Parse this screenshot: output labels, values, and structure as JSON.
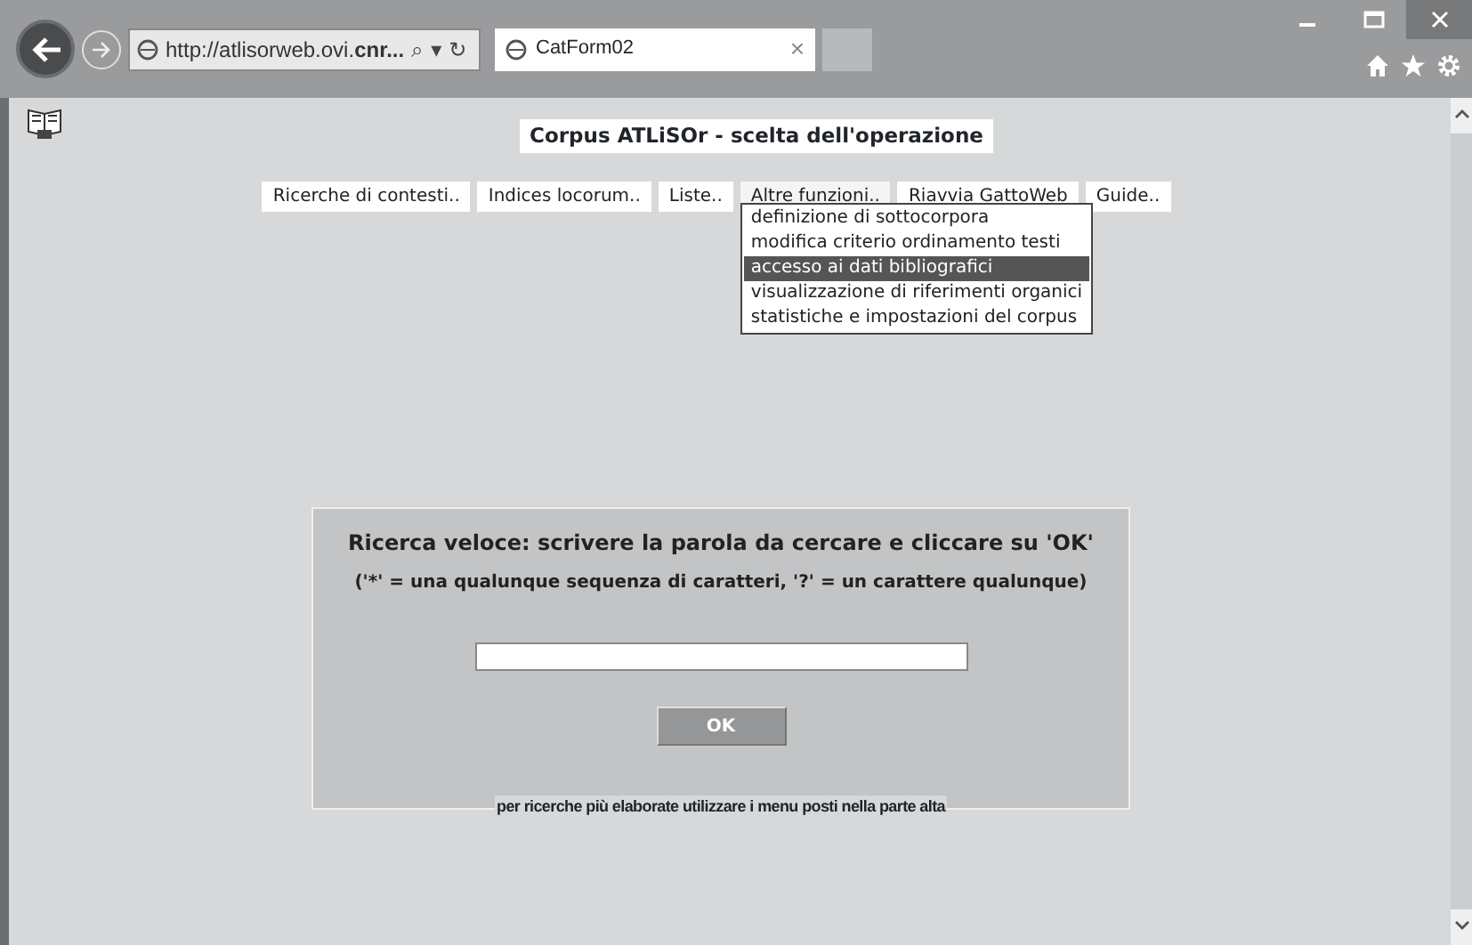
{
  "browser": {
    "address": "http://atlisorweb.ovi.**cnr...**",
    "search_glyph": "⌕",
    "dropdown_glyph": "▾",
    "refresh_glyph": "↻",
    "tab_title": "CatForm02",
    "tab_close": "×"
  },
  "page": {
    "title": "Corpus ATLiSOr - scelta dell'operazione",
    "menu": [
      {
        "label": "Ricerche di contesti..",
        "expanded": false
      },
      {
        "label": "Indices locorum..",
        "expanded": false
      },
      {
        "label": "Liste..",
        "expanded": false
      },
      {
        "label": "Altre funzioni..",
        "expanded": true
      },
      {
        "label": "Riavvia GattoWeb",
        "expanded": false
      },
      {
        "label": "Guide..",
        "expanded": false
      }
    ],
    "dropdown": [
      {
        "label": "definizione di sottocorpora",
        "selected": false
      },
      {
        "label": "modifica criterio ordinamento testi",
        "selected": false
      },
      {
        "label": "accesso ai dati bibliografici",
        "selected": true
      },
      {
        "label": "visualizzazione di riferimenti organici",
        "selected": false
      },
      {
        "label": "statistiche e impostazioni del corpus",
        "selected": false
      }
    ],
    "quick_search": {
      "title": "Ricerca veloce: scrivere la parola da cercare e cliccare su 'OK'",
      "hint": "('*' = una qualunque sequenza di caratteri, '?' = un carattere qualunque)",
      "button": "OK",
      "note": "per ricerche più elaborate utilizzare i menu posti nella parte alta"
    }
  }
}
